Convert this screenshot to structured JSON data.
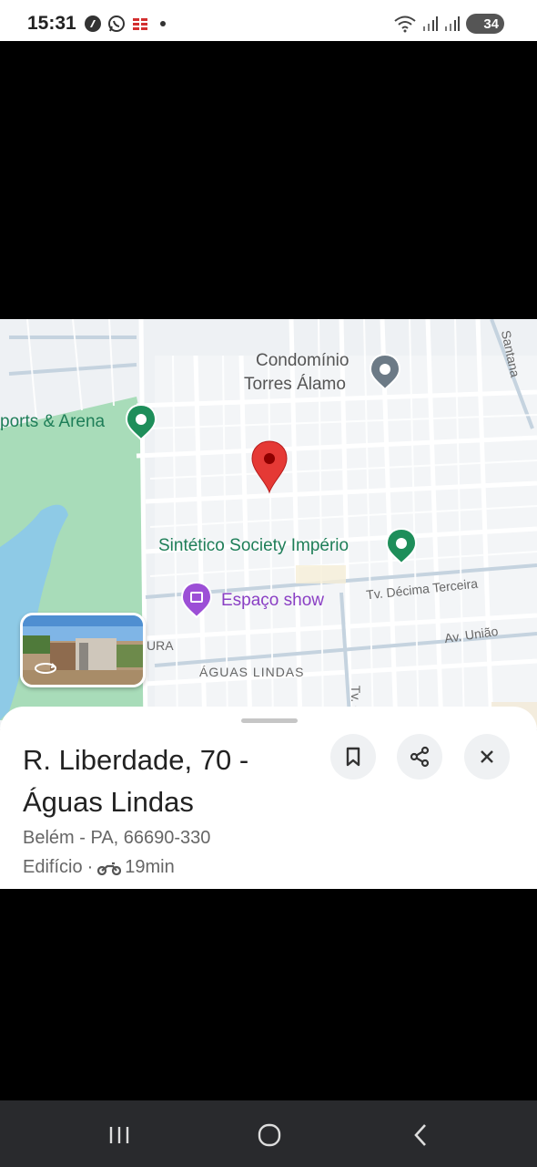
{
  "status_bar": {
    "time": "15:31",
    "battery": "34",
    "left_icons": [
      "nfc-app-icon",
      "whatsapp-icon",
      "app-icon",
      "dot"
    ],
    "right_icons": [
      "wifi-icon",
      "signal-icon",
      "signal-icon",
      "battery-icon"
    ]
  },
  "map": {
    "pois": {
      "condominio_line1": "Condomínio",
      "condominio_line2": "Torres Álamo",
      "arena": "ports & Arena",
      "sintetico": "Sintético Society Império",
      "espaco": "Espaço show"
    },
    "streets": {
      "santana": "Santana",
      "decima_terceira": "Tv. Décima Terceira",
      "uniao": "Av. União",
      "ura": "URA",
      "aguas_lindas": "ÁGUAS LINDAS",
      "tv": "Tv. C"
    },
    "colors": {
      "pin": "#e53935",
      "water": "#8ecae6",
      "park": "#a8dcb9",
      "poi_green": "#1e8e5a",
      "poi_purple": "#9c4fd6",
      "poi_gray": "#6c7a86"
    }
  },
  "place": {
    "title": "R. Liberdade, 70 - Águas Lindas",
    "address": "Belém - PA, 66690-330",
    "category": "Edifício",
    "separator": "·",
    "travel_time": "19min",
    "travel_mode_icon": "motorcycle-icon"
  },
  "actions": {
    "save_icon": "bookmark-icon",
    "share_icon": "share-icon",
    "close_icon": "close-icon"
  },
  "nav": {
    "recents_icon": "recents-icon",
    "home_icon": "home-icon",
    "back_icon": "back-icon"
  }
}
